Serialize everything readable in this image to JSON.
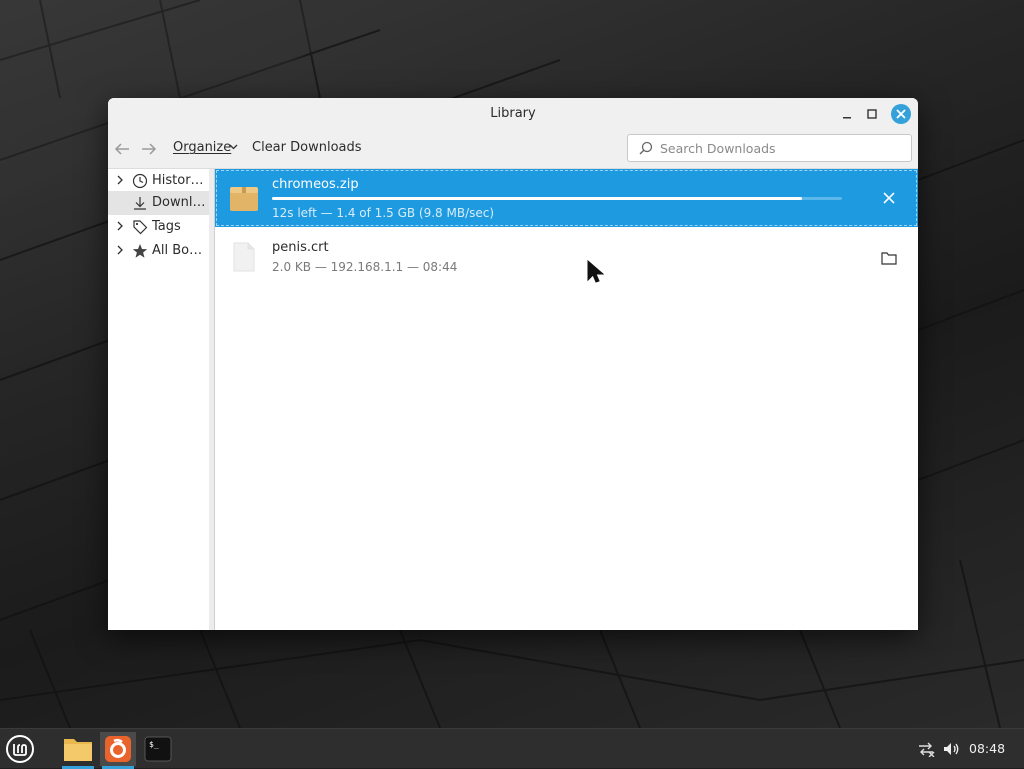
{
  "window": {
    "title": "Library"
  },
  "toolbar": {
    "organize_label": "Organize",
    "clear_label": "Clear Downloads",
    "search_placeholder": "Search Downloads"
  },
  "sidebar": {
    "items": [
      {
        "label": "Histor…",
        "icon": "clock-icon",
        "expandable": true,
        "selected": false
      },
      {
        "label": "Downl…",
        "icon": "download-icon",
        "expandable": false,
        "selected": true
      },
      {
        "label": "Tags",
        "icon": "tag-icon",
        "expandable": true,
        "selected": false
      },
      {
        "label": "All Bo…",
        "icon": "star-icon",
        "expandable": true,
        "selected": false
      }
    ]
  },
  "downloads": [
    {
      "name": "chromeos.zip",
      "status": "12s left — 1.4 of 1.5 GB (9.8 MB/sec)",
      "progress_percent": 93,
      "icon": "archive-icon",
      "action": "cancel-icon",
      "active": true
    },
    {
      "name": "penis.crt",
      "status": "2.0 KB — 192.168.1.1 — 08:44",
      "icon": "file-icon",
      "action": "folder-icon",
      "active": false
    }
  ],
  "taskbar": {
    "apps": [
      "menu-icon",
      "files-icon",
      "firefox-icon",
      "terminal-icon"
    ],
    "clock": "08:48"
  },
  "colors": {
    "accent": "#1e9ae0",
    "close_button": "#35a1da"
  }
}
